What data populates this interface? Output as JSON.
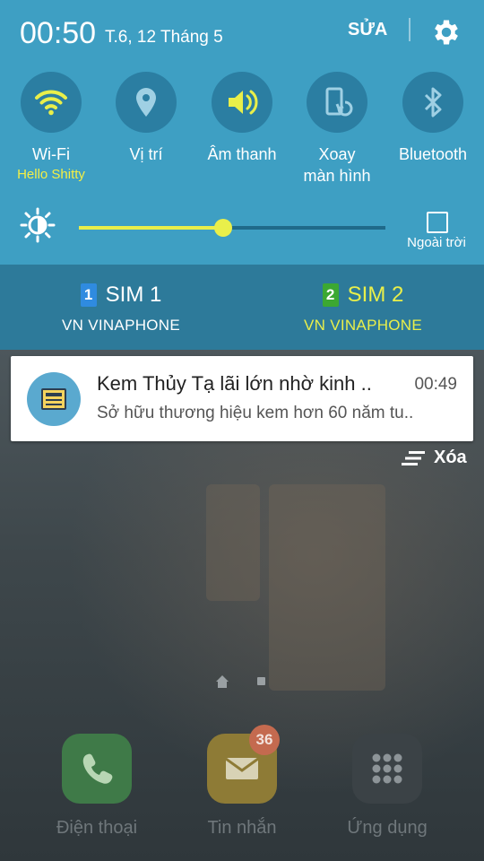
{
  "status": {
    "time": "00:50",
    "date": "T.6, 12 Tháng 5",
    "edit_label": "SỬA"
  },
  "quick_settings": [
    {
      "label": "Wi-Fi",
      "sublabel": "Hello Shitty",
      "icon": "wifi-icon",
      "active": true
    },
    {
      "label": "Vị trí",
      "icon": "location-icon",
      "active": false
    },
    {
      "label": "Âm thanh",
      "icon": "sound-icon",
      "active": true
    },
    {
      "label": "Xoay\nmàn hình",
      "icon": "rotate-icon",
      "active": false
    },
    {
      "label": "Bluetooth",
      "icon": "bluetooth-icon",
      "active": false
    }
  ],
  "brightness": {
    "level": 0.47,
    "outdoor_label": "Ngoài trời"
  },
  "sims": [
    {
      "number": "1",
      "name": "SIM 1",
      "carrier": "VN VINAPHONE",
      "color": "#ffffff",
      "badge_color": "#2f8be0"
    },
    {
      "number": "2",
      "name": "SIM 2",
      "carrier": "VN VINAPHONE",
      "color": "#e9ef4a",
      "badge_color": "#3ca832"
    }
  ],
  "notification": {
    "title": "Kem Thủy Tạ lãi lớn nhờ kinh ..",
    "time": "00:49",
    "body": "Sở hữu thương hiệu kem hơn 60 năm tu.."
  },
  "clear_label": "Xóa",
  "dock": [
    {
      "label": "Điện thoại",
      "icon": "phone-icon"
    },
    {
      "label": "Tin nhắn",
      "icon": "message-icon",
      "badge": "36"
    },
    {
      "label": "Ứng dụng",
      "icon": "apps-icon"
    }
  ],
  "colors": {
    "panel": "#3e9fc3",
    "sim_bar": "#2d7a9a",
    "accent_yellow": "#e9ef4a"
  }
}
